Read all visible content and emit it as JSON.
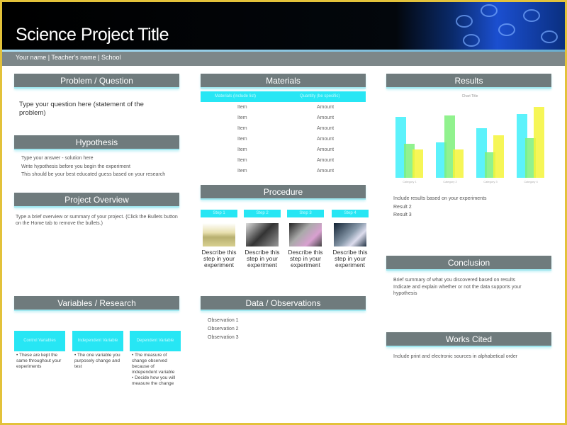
{
  "header": {
    "title": "Science Project Title",
    "subtitle": "Your name | Teacher's name | School"
  },
  "colors": {
    "accent": "#27e6f4",
    "section_header": "#6f7b7d",
    "border": "#e3c23a"
  },
  "problem": {
    "heading": "Problem / Question",
    "text": "Type your question here (statement of the problem)"
  },
  "hypothesis": {
    "heading": "Hypothesis",
    "lines": [
      "Type your answer - solution here",
      "Write hypothesis before you begin the experiment",
      "This should be your best educated guess based on your research"
    ]
  },
  "overview": {
    "heading": "Project Overview",
    "text": "Type a brief overview or summary of your project. (Click the Bullets button on the Home tab to remove the bullets.)"
  },
  "variables": {
    "heading": "Variables / Research",
    "boxes": [
      {
        "label": "Control Variables",
        "bullets": [
          "These are kept the same throughout your experiments"
        ]
      },
      {
        "label": "Independent Variable",
        "bullets": [
          "The one variable you purposely change and test"
        ]
      },
      {
        "label": "Dependent Variable",
        "bullets": [
          "The measure of change observed because of independent variable",
          "Decide how you will measure the change"
        ]
      }
    ]
  },
  "materials": {
    "heading": "Materials",
    "columns": [
      "Materials (include list)",
      "Quantity (be specific)"
    ],
    "rows": [
      [
        "Item",
        "Amount"
      ],
      [
        "Item",
        "Amount"
      ],
      [
        "Item",
        "Amount"
      ],
      [
        "Item",
        "Amount"
      ],
      [
        "Item",
        "Amount"
      ],
      [
        "Item",
        "Amount"
      ],
      [
        "Item",
        "Amount"
      ]
    ]
  },
  "procedure": {
    "heading": "Procedure",
    "steps": [
      {
        "label": "Step 1",
        "text": "Describe this step in your experiment"
      },
      {
        "label": "Step 2",
        "text": "Describe this step in your experiment"
      },
      {
        "label": "Step 3",
        "text": "Describe this step in your experiment"
      },
      {
        "label": "Step 4",
        "text": "Describe this step in your experiment"
      }
    ]
  },
  "observations": {
    "heading": "Data / Observations",
    "items": [
      "Observation 1",
      "Observation 2",
      "Observation 3"
    ]
  },
  "results": {
    "heading": "Results",
    "lines": [
      "Include results based on your experiments",
      "Result 2",
      "Result 3"
    ]
  },
  "chart_data": {
    "type": "bar",
    "title": "Chart Title",
    "categories": [
      "Category 1",
      "Category 2",
      "Category 3",
      "Category 4"
    ],
    "series": [
      {
        "values": [
          4.3,
          2.5,
          3.5,
          4.5
        ],
        "color": "#3ff0fa"
      },
      {
        "values": [
          2.4,
          4.4,
          1.8,
          2.8
        ],
        "color": "#7ef07a"
      },
      {
        "values": [
          2,
          2,
          3,
          5
        ],
        "color": "#f5f53a"
      }
    ],
    "ylim": [
      0,
      5.5
    ],
    "grid": false
  },
  "conclusion": {
    "heading": "Conclusion",
    "lines": [
      "Brief summary of what you discovered based on results",
      "Indicate and explain whether or not the data supports your hypothesis"
    ]
  },
  "works_cited": {
    "heading": "Works Cited",
    "text": "Include print and electronic sources in alphabetical order"
  }
}
